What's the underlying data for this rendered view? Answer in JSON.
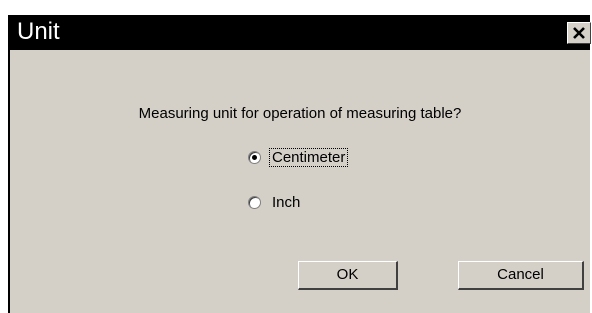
{
  "dialog": {
    "title": "Unit",
    "question": "Measuring unit for operation of measuring table?",
    "options": [
      {
        "label": "Centimeter",
        "selected": true
      },
      {
        "label": "Inch",
        "selected": false
      }
    ],
    "ok_label": "OK",
    "cancel_label": "Cancel"
  },
  "icons": {
    "close": "close-icon"
  },
  "colors": {
    "titlebar": "#000000",
    "title_text": "#ffffff",
    "dialog_bg": "#d4d0c8"
  }
}
